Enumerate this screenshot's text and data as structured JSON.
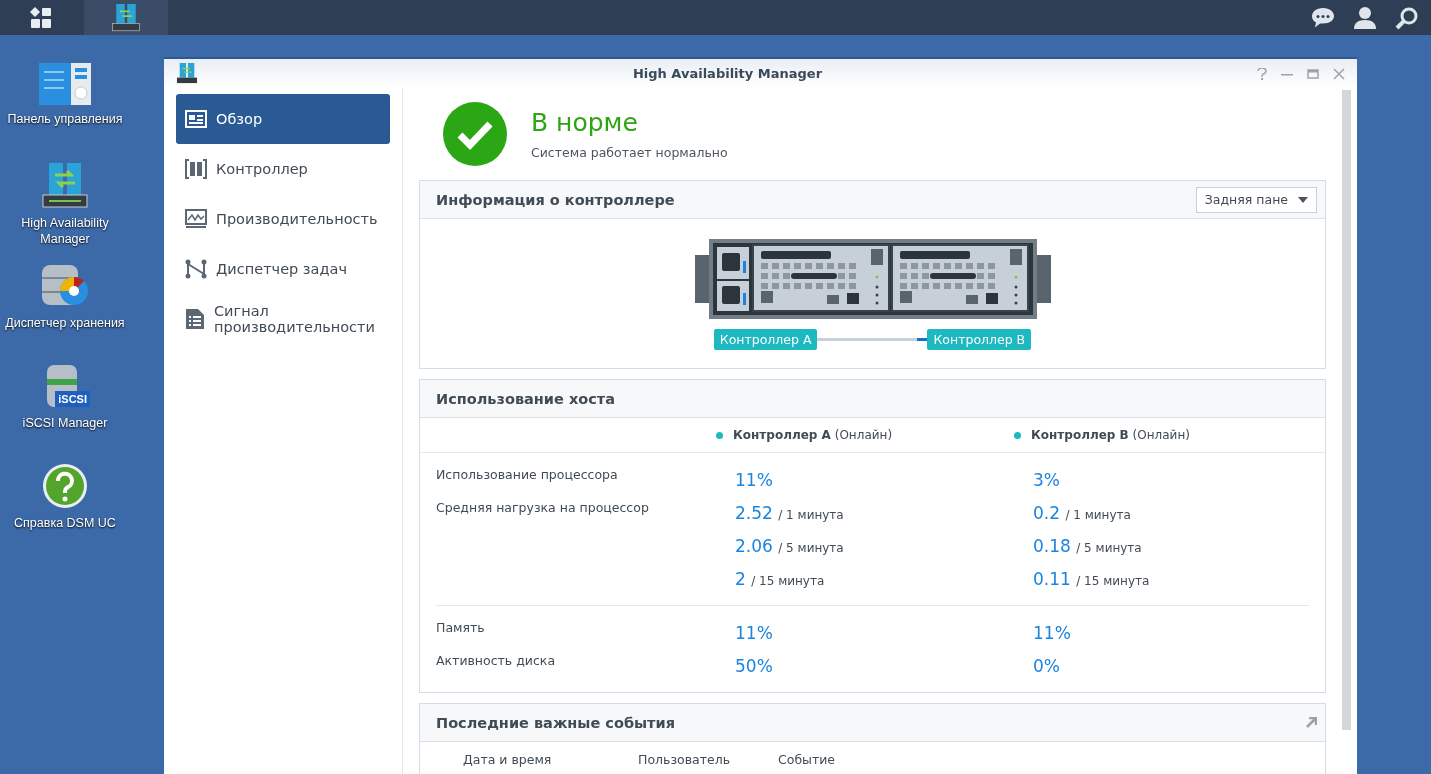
{
  "desktop_icons": [
    {
      "kind": "control-panel",
      "label": "Панель управления"
    },
    {
      "kind": "ha",
      "label": "High Availability Manager"
    },
    {
      "kind": "storage",
      "label": "Диспетчер хранения"
    },
    {
      "kind": "iscsi",
      "label": "iSCSI Manager",
      "badge": "iSCSI"
    },
    {
      "kind": "help",
      "label": "Справка DSM UC"
    }
  ],
  "window": {
    "title": "High Availability Manager"
  },
  "sidebar": {
    "items": [
      {
        "kind": "overview",
        "label": "Обзор",
        "selected": true
      },
      {
        "kind": "controller",
        "label": "Контроллер",
        "selected": false
      },
      {
        "kind": "performance",
        "label": "Производительность",
        "selected": false
      },
      {
        "kind": "tasks",
        "label": "Диспетчер задач",
        "selected": false
      },
      {
        "kind": "alert",
        "label": "Сигнал производительности",
        "selected": false
      }
    ]
  },
  "status": {
    "title": "В норме",
    "subtitle": "Система работает нормально"
  },
  "controller_info": {
    "title": "Информация о контроллере",
    "view": "Задняя пане",
    "labels": [
      "Контроллер A",
      "Контроллер B"
    ]
  },
  "host_usage": {
    "title": "Использование хоста",
    "controllers": [
      {
        "name": "Контроллер A",
        "status": "(Онлайн)",
        "color": "#1cb9c0"
      },
      {
        "name": "Контроллер B",
        "status": "(Онлайн)",
        "color": "#1cb9c0"
      }
    ],
    "groups": [
      [
        {
          "label": "Использование процессора",
          "cells": [
            {
              "value": "11%"
            },
            {
              "value": "3%"
            }
          ]
        },
        {
          "label": "Средняя нагрузка на процессор",
          "cells": [
            {
              "value": "2.52",
              "unit": "/ 1 минута"
            },
            {
              "value": "0.2",
              "unit": "/ 1 минута"
            }
          ]
        },
        {
          "cells": [
            {
              "value": "2.06",
              "unit": "/ 5 минута"
            },
            {
              "value": "0.18",
              "unit": "/ 5 минута"
            }
          ]
        },
        {
          "cells": [
            {
              "value": "2",
              "unit": "/ 15 минута"
            },
            {
              "value": "0.11",
              "unit": "/ 15 минута"
            }
          ]
        }
      ],
      [
        {
          "label": "Память",
          "cells": [
            {
              "value": "11%"
            },
            {
              "value": "11%"
            }
          ]
        },
        {
          "label": "Активность диска",
          "cells": [
            {
              "value": "50%"
            },
            {
              "value": "0%"
            }
          ]
        }
      ]
    ]
  },
  "events": {
    "title": "Последние важные события",
    "columns": [
      "Дата и время",
      "Пользователь",
      "Событие"
    ]
  }
}
